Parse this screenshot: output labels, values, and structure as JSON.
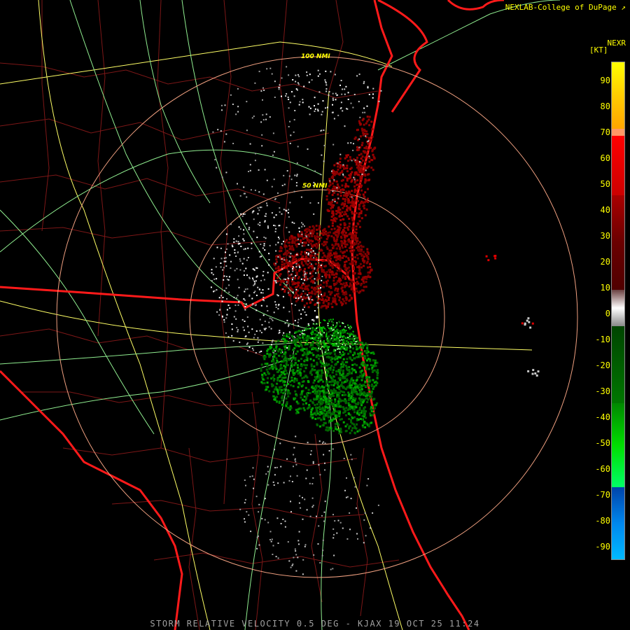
{
  "header": {
    "credit": "NEXLAB-College of DuPage",
    "product": "NEXR",
    "units": "[KT]"
  },
  "legend": {
    "ticks": [
      "90",
      "80",
      "70",
      "60",
      "50",
      "40",
      "30",
      "20",
      "10",
      "0",
      "-10",
      "-20",
      "-30",
      "-40",
      "-50",
      "-60",
      "-70",
      "-80",
      "-90"
    ],
    "colors": {
      "outbound_high": "#ffcc00",
      "outbound_peach": "#ff9966",
      "outbound_red": "#ff0000",
      "outbound_dark": "#8b0000",
      "near_zero": "#c8c8c8",
      "inbound_dark": "#006600",
      "inbound_green": "#00cc00",
      "inbound_blue": "#0066cc",
      "inbound_light_blue": "#00aaff"
    }
  },
  "map": {
    "ring_labels": [
      "100 NMI",
      "50 NMI"
    ],
    "radar_site": "KJAX"
  },
  "footer": {
    "caption": "STORM RELATIVE VELOCITY 0.5 DEG - KJAX 19 OCT 25 11:24"
  }
}
